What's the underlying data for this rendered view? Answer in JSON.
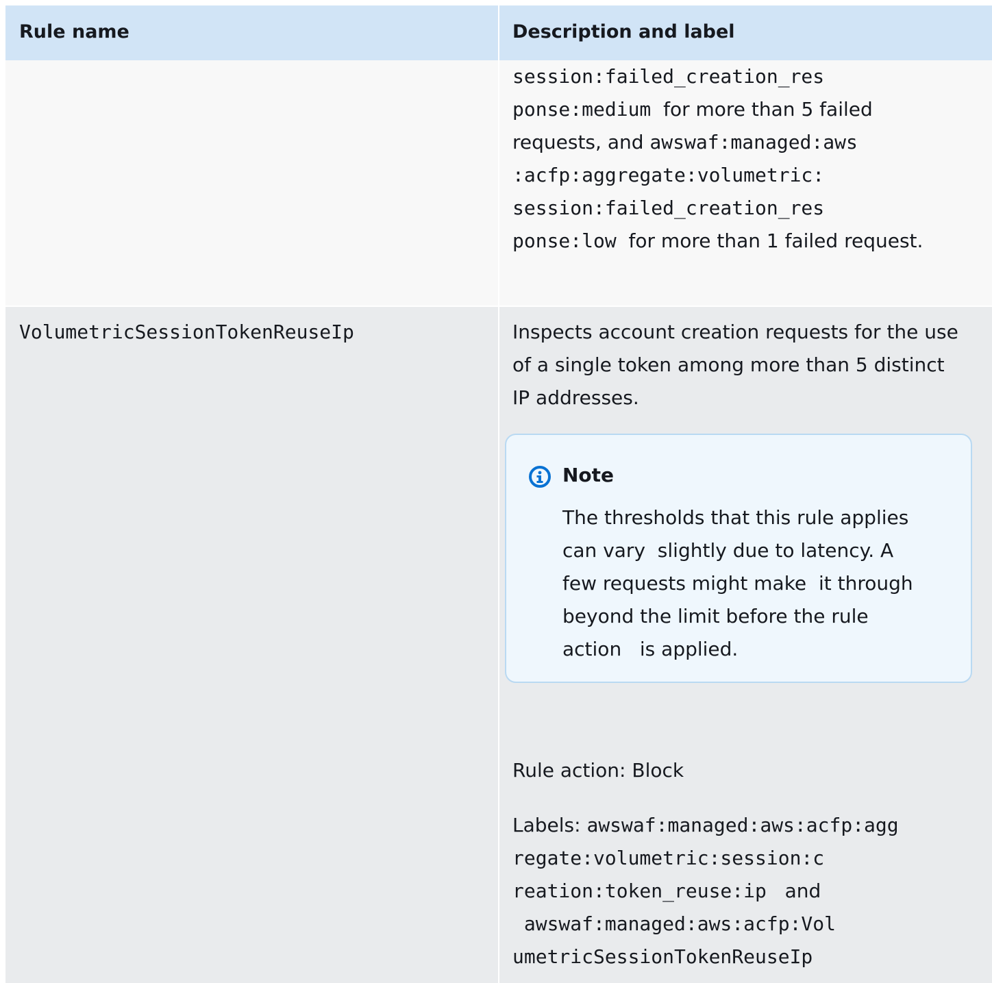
{
  "table": {
    "headers": {
      "rule_name": "Rule name",
      "description": "Description and label"
    },
    "row1": {
      "description_lines": [
        {
          "parts": [
            {
              "t": "session:failed_creation_res",
              "mono": true
            }
          ]
        },
        {
          "parts": [
            {
              "t": "ponse:medium",
              "mono": true
            },
            {
              "t": "  for more than 5 failed",
              "mono": false
            }
          ]
        },
        {
          "parts": [
            {
              "t": "requests, and ",
              "mono": false
            },
            {
              "t": "awswaf:managed:aws",
              "mono": true
            }
          ]
        },
        {
          "parts": [
            {
              "t": ":acfp:aggregate:volumetric:",
              "mono": true
            }
          ]
        },
        {
          "parts": [
            {
              "t": "session:failed_creation_res",
              "mono": true
            }
          ]
        },
        {
          "parts": [
            {
              "t": "ponse:low",
              "mono": true
            },
            {
              "t": "  for more than 1 failed request.",
              "mono": false
            }
          ]
        }
      ]
    },
    "row2": {
      "rule_name": "VolumetricSessionTokenReuseIp",
      "description_lines": [
        "Inspects account creation requests for the use",
        "of a single token among more than 5 distinct",
        "IP addresses."
      ],
      "note": {
        "icon": "info-icon",
        "title": "Note",
        "lines": [
          "The thresholds that this rule applies",
          "can vary  slightly due to latency. A",
          "few requests might make  it through",
          "beyond the limit before the rule",
          "action   is applied."
        ]
      },
      "rule_action": "Rule action: Block",
      "labels_lines": [
        {
          "parts": [
            {
              "t": "Labels: ",
              "mono": false
            },
            {
              "t": "awswaf:managed:aws:acfp:agg",
              "mono": true
            }
          ]
        },
        {
          "parts": [
            {
              "t": "regate:volumetric:session:c",
              "mono": true
            }
          ]
        },
        {
          "parts": [
            {
              "t": "reation:token_reuse:ip",
              "mono": true
            },
            {
              "t": "   and",
              "mono": false
            }
          ]
        },
        {
          "parts": [
            {
              "t": " awswaf:managed:aws:acfp:Vol",
              "mono": true
            }
          ]
        },
        {
          "parts": [
            {
              "t": "umetricSessionTokenReuseIp",
              "mono": true
            }
          ]
        }
      ]
    }
  },
  "colors": {
    "header_bg": "#d1e4f6",
    "row_alt_bg": "#f8f8f8",
    "row_bg": "#e9ebed",
    "note_bg": "#eff7fd",
    "note_border": "#b9d9f2",
    "info_icon": "#0972d3"
  }
}
